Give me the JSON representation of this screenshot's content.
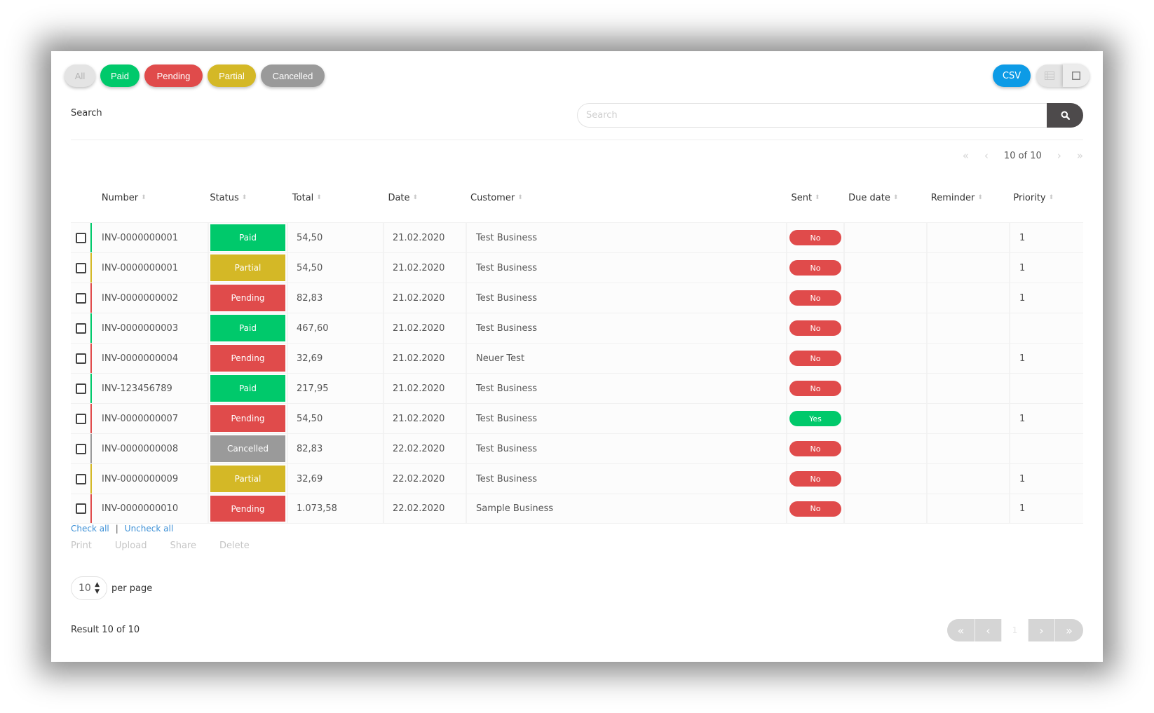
{
  "filters": {
    "all": "All",
    "paid": "Paid",
    "pending": "Pending",
    "partial": "Partial",
    "cancelled": "Cancelled"
  },
  "toolbar": {
    "csv_label": "CSV",
    "view_list_icon": "list-view-icon",
    "view_grid_icon": "grid-view-icon"
  },
  "search": {
    "label": "Search",
    "placeholder": "Search",
    "value": "",
    "button_icon": "search-icon"
  },
  "top_pager": {
    "text": "10 of 10",
    "first": "«",
    "prev": "‹",
    "next": "›",
    "last": "»"
  },
  "table": {
    "columns": [
      "Number",
      "Status",
      "Total",
      "Date",
      "Customer",
      "Sent",
      "Due date",
      "Reminder",
      "Priority"
    ],
    "sort_icon": "⬍",
    "rows": [
      {
        "number": "INV-0000000001",
        "status": "Paid",
        "total": "54,50",
        "date": "21.02.2020",
        "customer": "Test Business",
        "sent": "No",
        "due_date": "",
        "reminder": "",
        "priority": "1"
      },
      {
        "number": "INV-0000000001",
        "status": "Partial",
        "total": "54,50",
        "date": "21.02.2020",
        "customer": "Test Business",
        "sent": "No",
        "due_date": "",
        "reminder": "",
        "priority": "1"
      },
      {
        "number": "INV-0000000002",
        "status": "Pending",
        "total": "82,83",
        "date": "21.02.2020",
        "customer": "Test Business",
        "sent": "No",
        "due_date": "",
        "reminder": "",
        "priority": "1"
      },
      {
        "number": "INV-0000000003",
        "status": "Paid",
        "total": "467,60",
        "date": "21.02.2020",
        "customer": "Test Business",
        "sent": "No",
        "due_date": "",
        "reminder": "",
        "priority": ""
      },
      {
        "number": "INV-0000000004",
        "status": "Pending",
        "total": "32,69",
        "date": "21.02.2020",
        "customer": "Neuer Test",
        "sent": "No",
        "due_date": "",
        "reminder": "",
        "priority": "1"
      },
      {
        "number": "INV-123456789",
        "status": "Paid",
        "total": "217,95",
        "date": "21.02.2020",
        "customer": "Test Business",
        "sent": "No",
        "due_date": "",
        "reminder": "",
        "priority": ""
      },
      {
        "number": "INV-0000000007",
        "status": "Pending",
        "total": "54,50",
        "date": "21.02.2020",
        "customer": "Test Business",
        "sent": "Yes",
        "due_date": "",
        "reminder": "",
        "priority": "1"
      },
      {
        "number": "INV-0000000008",
        "status": "Cancelled",
        "total": "82,83",
        "date": "22.02.2020",
        "customer": "Test Business",
        "sent": "No",
        "due_date": "",
        "reminder": "",
        "priority": ""
      },
      {
        "number": "INV-0000000009",
        "status": "Partial",
        "total": "32,69",
        "date": "22.02.2020",
        "customer": "Test Business",
        "sent": "No",
        "due_date": "",
        "reminder": "",
        "priority": "1"
      },
      {
        "number": "INV-0000000010",
        "status": "Pending",
        "total": "1.073,58",
        "date": "22.02.2020",
        "customer": "Sample Business",
        "sent": "No",
        "due_date": "",
        "reminder": "",
        "priority": "1"
      }
    ]
  },
  "selection": {
    "check_all": "Check all",
    "separator": "|",
    "uncheck_all": "Uncheck all"
  },
  "bulk_actions": [
    "Print",
    "Upload",
    "Share",
    "Delete"
  ],
  "per_page": {
    "value": "10",
    "label": "per page"
  },
  "result_text": "Result 10 of 10",
  "bottom_pager": {
    "first": "«",
    "prev": "‹",
    "current": "1",
    "next": "›",
    "last": "»"
  },
  "colors": {
    "paid": "#00c96b",
    "pending": "#e04b4b",
    "partial": "#d4b826",
    "cancelled": "#9a9a9a",
    "sent_yes": "#00c96b",
    "sent_no": "#e04b4b",
    "csv": "#0d9be6",
    "search_button": "#4d4a4b",
    "link": "#3b8fd6"
  }
}
